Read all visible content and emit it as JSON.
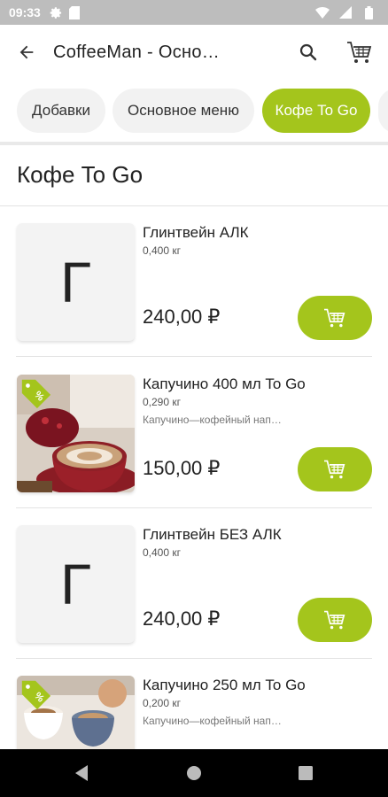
{
  "status_bar": {
    "time": "09:33",
    "icons": [
      "settings-icon",
      "sd-card-icon",
      "wifi-icon",
      "signal-icon",
      "battery-icon"
    ]
  },
  "app_bar": {
    "title": "CoffeeMan - Осно…",
    "back_icon": "arrow-left-icon",
    "search_icon": "search-icon",
    "cart_icon": "cart-icon"
  },
  "tabs": [
    {
      "label": "Добавки",
      "active": false
    },
    {
      "label": "Основное меню",
      "active": false
    },
    {
      "label": "Кофе To Go",
      "active": true
    }
  ],
  "section_title": "Кофе To Go",
  "products": [
    {
      "name": "Глинтвейн АЛК",
      "weight": "0,400 кг",
      "description": "",
      "price": "240,00 ₽",
      "placeholder": "Г",
      "has_photo": false,
      "promo": false
    },
    {
      "name": "Капучино 400 мл To Go",
      "weight": "0,290 кг",
      "description": "Капучино—кофейный нап…",
      "price": "150,00 ₽",
      "placeholder": "",
      "has_photo": true,
      "promo": true
    },
    {
      "name": "Глинтвейн БЕЗ АЛК",
      "weight": "0,400 кг",
      "description": "",
      "price": "240,00 ₽",
      "placeholder": "Г",
      "has_photo": false,
      "promo": false
    },
    {
      "name": "Капучино 250 мл To Go",
      "weight": "0,200 кг",
      "description": "Капучино—кофейный нап…",
      "price": "",
      "placeholder": "",
      "has_photo": true,
      "promo": true
    }
  ],
  "colors": {
    "accent": "#a4c51c",
    "status_bar": "#bdbdbd",
    "nav_bar": "#000000",
    "chip_bg": "#f2f2f2"
  },
  "nav_bar": {
    "icons": [
      "back-triangle-icon",
      "home-circle-icon",
      "recents-square-icon"
    ]
  }
}
